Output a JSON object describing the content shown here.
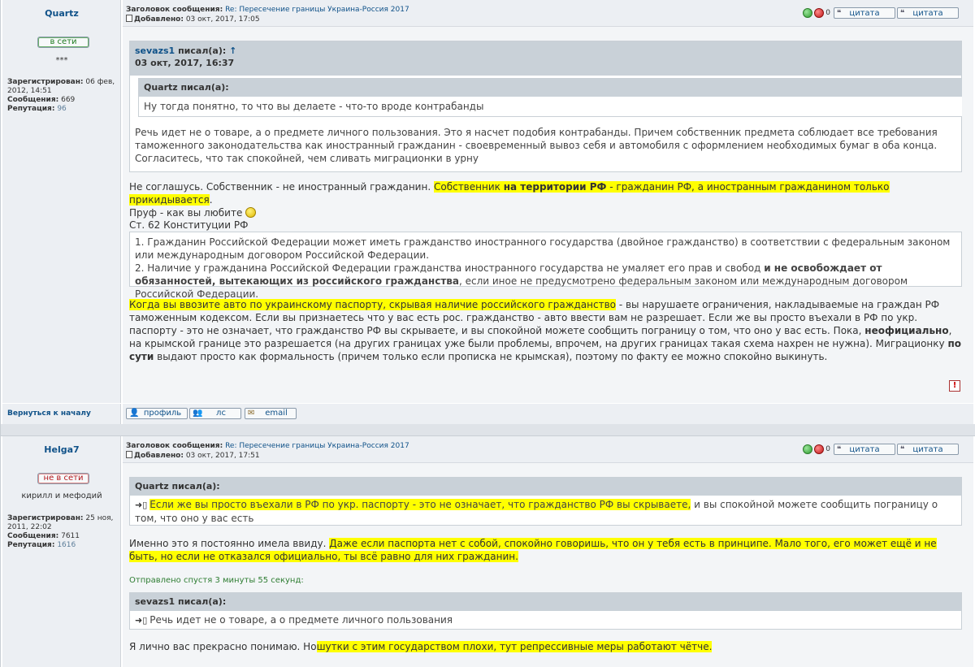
{
  "post1": {
    "author": "Quartz",
    "status": "в сети",
    "rank": "***",
    "registered_label": "Зарегистрирован:",
    "registered_value": "06 фев, 2012, 14:51",
    "posts_label": "Сообщения:",
    "posts_value": "669",
    "rep_label": "Репутация:",
    "rep_value": "96",
    "subject_label": "Заголовок сообщения:",
    "subject": "Re: Пересечение границы Украина-Россия 2017",
    "added_label": "Добавлено:",
    "added_value": "03 окт, 2017, 17:05",
    "votes": "0",
    "quote_btn": "цитата",
    "quote_btn2": "цитата",
    "outer_quote_user": "sevazs1",
    "outer_quote_wrote": "писал(а):",
    "outer_quote_arrow": "↑",
    "outer_quote_date": "03 окт, 2017, 16:37",
    "inner_quote_header": "Quartz писал(а):",
    "inner_quote_text": "Ну тогда понятно, то что вы делаете - что-то вроде контрабанды",
    "outer_quote_text": "Речь идет не о товаре, а о предмете личного пользования. Это я насчет подобия контрабанды. Причем собственник предмета соблюдает все требования таможенного законодательства как иностранный гражданин - своевременный вывоз себя и автомобиля с оформлением необходимых бумаг в оба конца. Согласитесь, что так спокойней, чем сливать миграционки в урну",
    "p1_a": "Не соглашусь. Собственник - не иностранный гражданин.",
    "p1_hl_a": "Собственник",
    "p1_hl_b": "на территории РФ",
    "p1_hl_c": "- гражданин РФ, а иностранным гражданином только прикидывается",
    "p1_b": ".",
    "p1_c": "Пруф - как вы любите",
    "article_title": "Ст. 62 Конституции РФ",
    "const_1": "1. Гражданин Российской Федерации может иметь гражданство иностранного государства (двойное гражданство) в соответствии с федеральным законом или международным договором Российской Федерации.",
    "const_2a": "2. Наличие у гражданина Российской Федерации гражданства иностранного государства не умаляет его прав и свобод",
    "const_2b": "и не освобождает от обязанностей, вытекающих из российского гражданства",
    "const_2c": ", если иное не предусмотрено федеральным законом или международным договором Российской Федерации.",
    "p2_hl": "Когда вы ввозите авто по украинскому паспорту, скрывая наличие российского гражданство",
    "p2_a": " - вы нарушаете ограничения, накладываемые на граждан РФ таможенным кодексом. Если вы признаетесь что у вас есть рос. гражданство - авто ввести вам не разрешает. Если же вы просто въехали в РФ по укр. паспорту - это не означает, что гражданство РФ вы скрываете, и вы спокойной можете сообщить пограницу о том, что оно у вас есть. Пока,",
    "p2_b": "неофициально",
    "p2_c": ", на крымской границе это разрешается (на других границах уже были проблемы, впрочем, на других границах такая схема нахрен не нужна). Миграционку",
    "p2_d": "по сути",
    "p2_e": "выдают просто как формальность (причем только если прописка не крымская), поэтому по факту ее можно спокойно выкинуть.",
    "report": "!",
    "back_to_top": "Вернуться к началу",
    "profile_btn": "профиль",
    "pm_btn": "лс",
    "email_btn": "email"
  },
  "post2": {
    "author": "Helga7",
    "status": "не в сети",
    "rank": "кирилл и мефодий",
    "registered_label": "Зарегистрирован:",
    "registered_value": "25 ноя, 2011, 22:02",
    "posts_label": "Сообщения:",
    "posts_value": "7611",
    "rep_label": "Репутация:",
    "rep_value": "1616",
    "subject_label": "Заголовок сообщения:",
    "subject": "Re: Пересечение границы Украина-Россия 2017",
    "added_label": "Добавлено:",
    "added_value": "03 окт, 2017, 17:51",
    "votes": "0",
    "quote_btn": "цитата",
    "quote_btn2": "цитата",
    "quote1_header": "Quartz писал(а):",
    "quote1_hl": "Если же вы просто въехали в РФ по укр. паспорту - это не означает, что гражданство РФ вы скрываете,",
    "quote1_rest": " и вы спокойной можете сообщить пограницу о том, что оно у вас есть",
    "p1_a": "Именно это я постоянно имела ввиду.",
    "p1_hl": "Даже если паспорта нет с собой, спокойно говоришь, что он у тебя есть в принципе. Мало того, его может ещё и не быть, но если не отказался официально, ты всё равно для них гражданин.",
    "sent_after": "Отправлено спустя 3 минуты 55 секунд:",
    "quote2_header": "sevazs1 писал(а):",
    "quote2_text": "Речь идет не о товаре, а о предмете личного пользования",
    "p2_a": "Я лично вас прекрасно понимаю. Но",
    "p2_hl": "шутки с этим государством плохи, тут репрессивные меры работают чётче."
  }
}
